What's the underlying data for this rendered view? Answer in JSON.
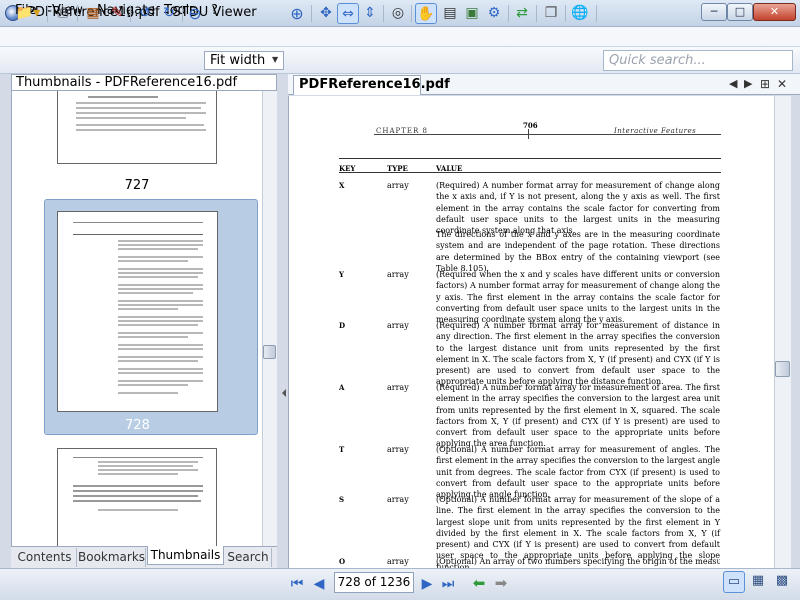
{
  "window": {
    "title": "PDFReference16.pdf - STDU Viewer"
  },
  "menu": {
    "file": "File",
    "view": "View",
    "navigate": "Navigate",
    "tools": "Tools",
    "help": "?"
  },
  "toolbar": {
    "zoom_value": "Fit width",
    "search_placeholder": "Quick search..."
  },
  "left_panel": {
    "header": "Thumbnails - PDFReference16.pdf",
    "thumbnails": [
      {
        "page": "727"
      },
      {
        "page": "728",
        "selected": true
      }
    ],
    "tabs": [
      {
        "label": "Contents"
      },
      {
        "label": "Bookmarks"
      },
      {
        "label": "Thumbnails",
        "active": true
      },
      {
        "label": "Search"
      }
    ]
  },
  "document": {
    "tab_label": "PDFReference16.pdf",
    "header": {
      "chapter": "CHAPTER 8",
      "page_number": "706",
      "section": "Interactive Features"
    },
    "columns": {
      "key": "KEY",
      "type": "TYPE",
      "value": "VALUE"
    },
    "entries": [
      {
        "key": "X",
        "type": "array",
        "value": "(Required) A number format array for measurement of change along the x axis and, if Y is not present, along the y axis as well. The first element in the array contains the scale factor for converting from default user space units to the largest units in the measuring coordinate system along that axis."
      },
      {
        "key": "",
        "type": "",
        "value": "The directions of the x and y axes are in the measuring coordinate system and are independent of the page rotation. These directions are determined by the BBox entry of the containing viewport (see Table 8.105)."
      },
      {
        "key": "Y",
        "type": "array",
        "value": "(Required when the x and y scales have different units or conversion factors) A number format array for measurement of change along the y axis. The first element in the array contains the scale factor for converting from default user space units to the largest units in the measuring coordinate system along the y axis."
      },
      {
        "key": "D",
        "type": "array",
        "value": "(Required) A number format array for measurement of distance in any direction. The first element in the array specifies the conversion to the largest distance unit from units represented by the first element in X. The scale factors from X, Y (if present) and CYX (if Y is present) are used to convert from default user space to the appropriate units before applying the distance function."
      },
      {
        "key": "A",
        "type": "array",
        "value": "(Required) A number format array for measurement of area. The first element in the array specifies the conversion to the largest area unit from units represented by the first element in X, squared. The scale factors from X, Y (if present) and CYX (if Y is present) are used to convert from default user space to the appropriate units before applying the area function."
      },
      {
        "key": "T",
        "type": "array",
        "value": "(Optional) A number format array for measurement of angles. The first element in the array specifies the conversion to the largest angle unit from degrees. The scale factor from CYX (if present) is used to convert from default user space to the appropriate units before applying the angle function."
      },
      {
        "key": "S",
        "type": "array",
        "value": "(Optional) A number format array for measurement of the slope of a line. The first element in the array specifies the conversion to the largest slope unit from units represented by the first element in Y divided by the first element in X. The scale factors from X, Y (if present) and CYX (if Y is present) are used to convert from default user space to the appropriate units before applying the slope function."
      },
      {
        "key": "O",
        "type": "array",
        "value": "(Optional) An array of two numbers specifying the origin of the measurement coor-"
      }
    ]
  },
  "status": {
    "page_indicator": "728 of 1236"
  }
}
